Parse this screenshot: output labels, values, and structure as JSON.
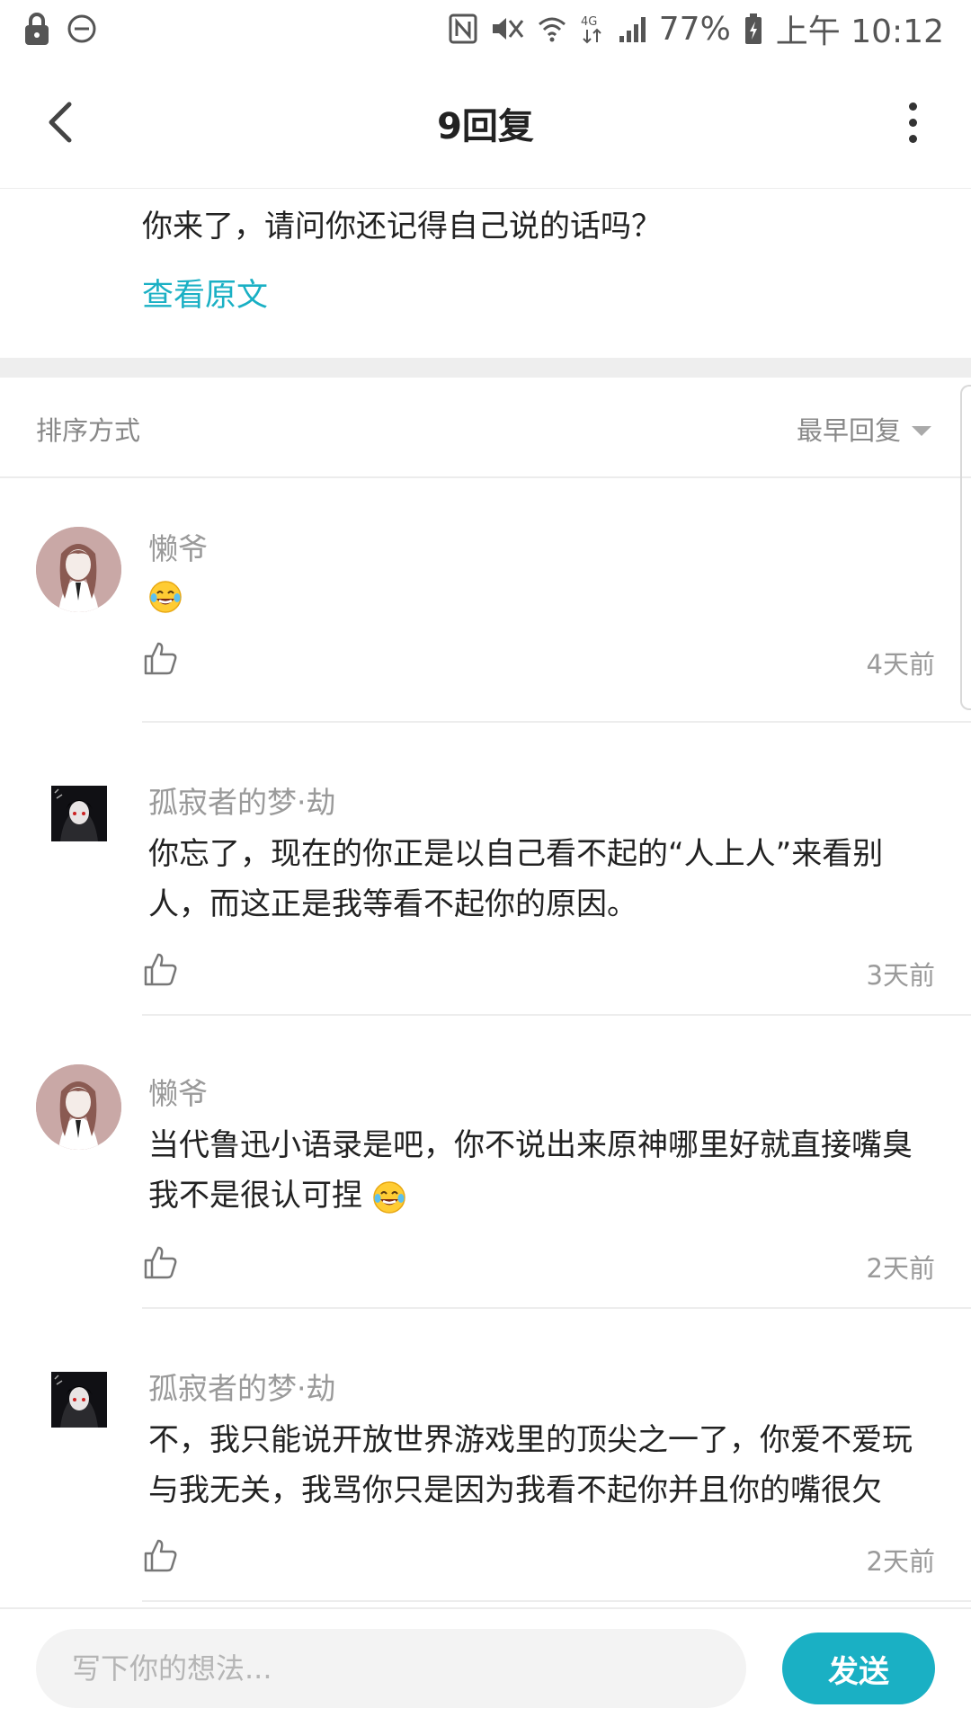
{
  "status_bar": {
    "battery": "77%",
    "time": "上午 10:12",
    "network": "4G"
  },
  "header": {
    "title": "9回复"
  },
  "original_post": {
    "text": "你来了，请问你还记得自己说的话吗？",
    "view_original": "查看原文"
  },
  "sort": {
    "label": "排序方式",
    "selected": "最早回复"
  },
  "comments": [
    {
      "name": "懒爷",
      "text": "",
      "time": "4天前",
      "avatar": "anime-girl-avatar"
    },
    {
      "name": "孤寂者的梦·劫",
      "text": "你忘了，现在的你正是以自己看不起的“人上人”来看别人，而这正是我等看不起你的原因。",
      "time": "3天前",
      "avatar": "dark-anime-avatar"
    },
    {
      "name": "懒爷",
      "text": "当代鲁迅小语录是吧，你不说出来原神哪里好就直接嘴臭我不是很认可捏",
      "time": "2天前",
      "avatar": "anime-girl-avatar"
    },
    {
      "name": "孤寂者的梦·劫",
      "text": "不，我只能说开放世界游戏里的顶尖之一了，你爱不爱玩与我无关，我骂你只是因为我看不起你并且你的嘴很欠",
      "time": "2天前",
      "avatar": "dark-anime-avatar"
    }
  ],
  "composer": {
    "placeholder": "写下你的想法...",
    "send_label": "发送"
  },
  "colors": {
    "accent": "#1ab0c4",
    "muted_text": "#9a9a9a"
  }
}
